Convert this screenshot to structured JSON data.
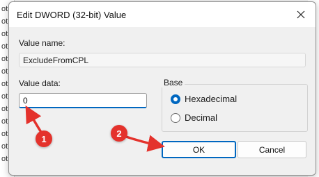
{
  "background": {
    "left_fragments": [
      "ot",
      "ot",
      "ot",
      "ot",
      "ot",
      "ot",
      "ot",
      "ot",
      "ot",
      "ot",
      "ot",
      "ot",
      "ot"
    ]
  },
  "dialog": {
    "title": "Edit DWORD (32-bit) Value",
    "value_name_label": "Value name:",
    "value_name": "ExcludeFromCPL",
    "value_data_label": "Value data:",
    "value_data": "0",
    "base_label": "Base",
    "base_options": [
      {
        "label": "Hexadecimal",
        "checked": true
      },
      {
        "label": "Decimal",
        "checked": false
      }
    ],
    "ok_label": "OK",
    "cancel_label": "Cancel"
  },
  "annotations": {
    "step1": "1",
    "step2": "2",
    "color": "#e4322c"
  },
  "colors": {
    "accent": "#0067c0"
  }
}
